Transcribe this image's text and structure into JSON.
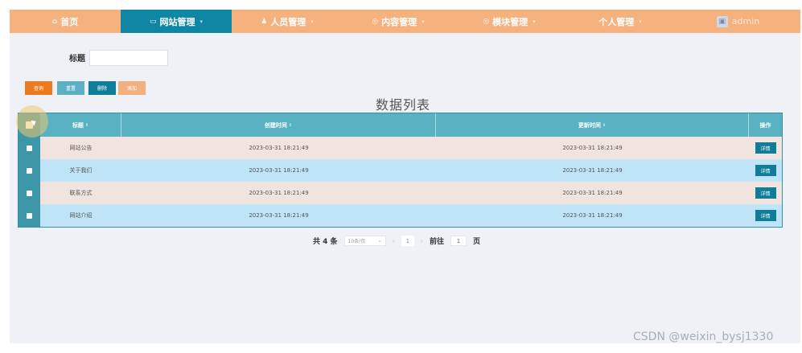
{
  "nav": {
    "items": [
      {
        "icon": "home-icon",
        "glyph": "⌂",
        "label": "首页"
      },
      {
        "icon": "monitor-icon",
        "glyph": "▭",
        "label": "网站管理"
      },
      {
        "icon": "user-icon",
        "glyph": "♟",
        "label": "人员管理"
      },
      {
        "icon": "content-icon",
        "glyph": "◎",
        "label": "内容管理"
      },
      {
        "icon": "module-icon",
        "glyph": "◎",
        "label": "模块管理"
      },
      {
        "icon": "",
        "glyph": "",
        "label": "个人管理"
      }
    ],
    "active_index": 1,
    "user": {
      "name": "admin"
    }
  },
  "search": {
    "label": "标题",
    "value": "",
    "placeholder": ""
  },
  "buttons": {
    "query": "查询",
    "reset": "重置",
    "delete": "删除",
    "add": "添加"
  },
  "list_title": "数据列表",
  "table": {
    "headers": {
      "title": "标题",
      "created": "创建时间",
      "updated": "更新时间",
      "operation": "操作"
    },
    "rows": [
      {
        "title": "网站公告",
        "created": "2023-03-31 18:21:49",
        "updated": "2023-03-31 18:21:49",
        "action": "详情"
      },
      {
        "title": "关于我们",
        "created": "2023-03-31 18:21:49",
        "updated": "2023-03-31 18:21:49",
        "action": "详情"
      },
      {
        "title": "联系方式",
        "created": "2023-03-31 18:21:49",
        "updated": "2023-03-31 18:21:49",
        "action": "详情"
      },
      {
        "title": "网站介绍",
        "created": "2023-03-31 18:21:49",
        "updated": "2023-03-31 18:21:49",
        "action": "详情"
      }
    ]
  },
  "pagination": {
    "total": "共 4 条",
    "page_size": "10条/页",
    "current_page": "1",
    "goto_label": "前往",
    "goto_value": "1",
    "page_unit": "页"
  },
  "watermark": "CSDN @weixin_bysj1330",
  "colors": {
    "nav_bg": "#f5b27e",
    "nav_active": "#0e86a4",
    "table_head": "#58b2c2",
    "row_odd": "#f1e4df",
    "row_even": "#c0e4f7"
  }
}
